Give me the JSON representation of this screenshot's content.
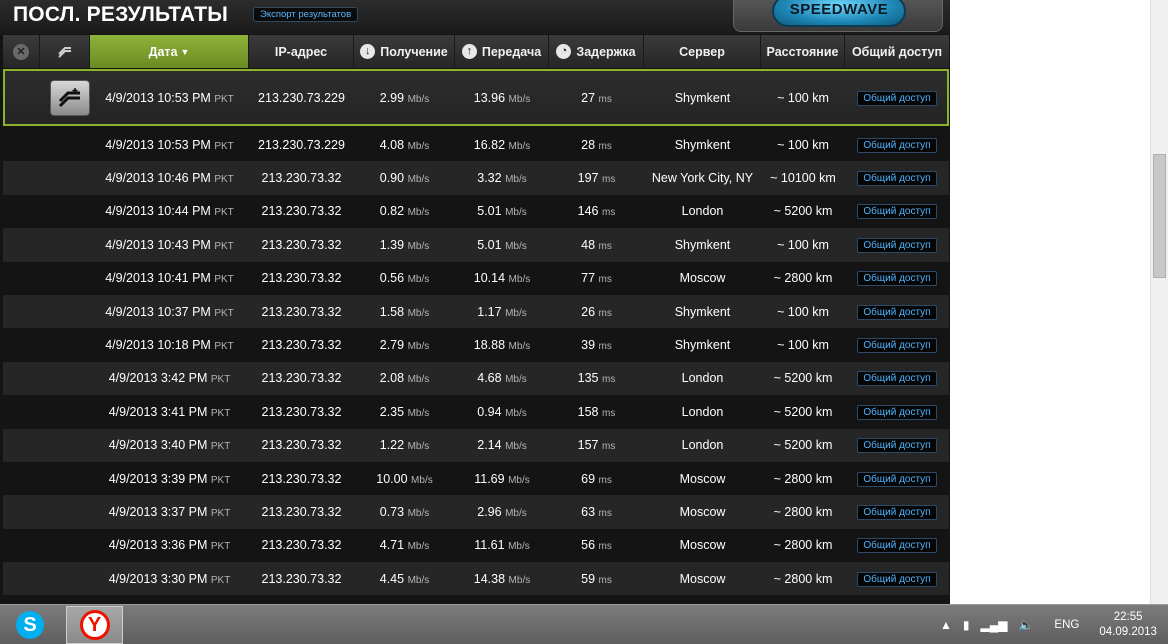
{
  "header": {
    "title": "ПОСЛ. РЕЗУЛЬТАТЫ",
    "export_label": "Экспорт результатов",
    "speedwave_label": "SPEEDWAVE"
  },
  "columns": {
    "date": "Дата",
    "ip": "IP-адрес",
    "download": "Получение",
    "upload": "Передача",
    "latency": "Задержка",
    "server": "Сервер",
    "distance": "Расстояние",
    "share": "Общий доступ"
  },
  "units": {
    "speed": "Mb/s",
    "ping": "ms",
    "tz": "PKT"
  },
  "share_label": "Общий доступ",
  "rows": [
    {
      "date": "4/9/2013 10:53 PM",
      "ip": "213.230.73.229",
      "down": "2.99",
      "up": "13.96",
      "ping": "27",
      "server": "Shymkent",
      "distance": "~ 100 km"
    },
    {
      "date": "4/9/2013 10:53 PM",
      "ip": "213.230.73.229",
      "down": "4.08",
      "up": "16.82",
      "ping": "28",
      "server": "Shymkent",
      "distance": "~ 100 km"
    },
    {
      "date": "4/9/2013 10:46 PM",
      "ip": "213.230.73.32",
      "down": "0.90",
      "up": "3.32",
      "ping": "197",
      "server": "New York City, NY",
      "distance": "~ 10100 km"
    },
    {
      "date": "4/9/2013 10:44 PM",
      "ip": "213.230.73.32",
      "down": "0.82",
      "up": "5.01",
      "ping": "146",
      "server": "London",
      "distance": "~ 5200 km"
    },
    {
      "date": "4/9/2013 10:43 PM",
      "ip": "213.230.73.32",
      "down": "1.39",
      "up": "5.01",
      "ping": "48",
      "server": "Shymkent",
      "distance": "~ 100 km"
    },
    {
      "date": "4/9/2013 10:41 PM",
      "ip": "213.230.73.32",
      "down": "0.56",
      "up": "10.14",
      "ping": "77",
      "server": "Moscow",
      "distance": "~ 2800 km"
    },
    {
      "date": "4/9/2013 10:37 PM",
      "ip": "213.230.73.32",
      "down": "1.58",
      "up": "1.17",
      "ping": "26",
      "server": "Shymkent",
      "distance": "~ 100 km"
    },
    {
      "date": "4/9/2013 10:18 PM",
      "ip": "213.230.73.32",
      "down": "2.79",
      "up": "18.88",
      "ping": "39",
      "server": "Shymkent",
      "distance": "~ 100 km"
    },
    {
      "date": "4/9/2013 3:42 PM",
      "ip": "213.230.73.32",
      "down": "2.08",
      "up": "4.68",
      "ping": "135",
      "server": "London",
      "distance": "~ 5200 km"
    },
    {
      "date": "4/9/2013 3:41 PM",
      "ip": "213.230.73.32",
      "down": "2.35",
      "up": "0.94",
      "ping": "158",
      "server": "London",
      "distance": "~ 5200 km"
    },
    {
      "date": "4/9/2013 3:40 PM",
      "ip": "213.230.73.32",
      "down": "1.22",
      "up": "2.14",
      "ping": "157",
      "server": "London",
      "distance": "~ 5200 km"
    },
    {
      "date": "4/9/2013 3:39 PM",
      "ip": "213.230.73.32",
      "down": "10.00",
      "up": "11.69",
      "ping": "69",
      "server": "Moscow",
      "distance": "~ 2800 km"
    },
    {
      "date": "4/9/2013 3:37 PM",
      "ip": "213.230.73.32",
      "down": "0.73",
      "up": "2.96",
      "ping": "63",
      "server": "Moscow",
      "distance": "~ 2800 km"
    },
    {
      "date": "4/9/2013 3:36 PM",
      "ip": "213.230.73.32",
      "down": "4.71",
      "up": "11.61",
      "ping": "56",
      "server": "Moscow",
      "distance": "~ 2800 km"
    },
    {
      "date": "4/9/2013 3:30 PM",
      "ip": "213.230.73.32",
      "down": "4.45",
      "up": "14.38",
      "ping": "59",
      "server": "Moscow",
      "distance": "~ 2800 km"
    }
  ],
  "taskbar": {
    "language": "ENG",
    "time": "22:55",
    "date": "04.09.2013"
  },
  "icons": {
    "sort": "sort-desc-icon",
    "skype": "skype-icon",
    "yandex": "yandex-browser-icon"
  },
  "colors": {
    "accent_green": "#8ab32a",
    "link_blue": "#4fb3ff",
    "speedwave_blue": "#1e86b5"
  }
}
